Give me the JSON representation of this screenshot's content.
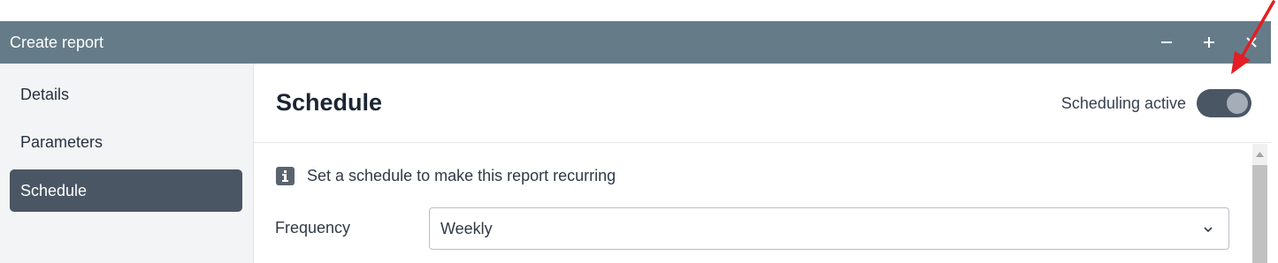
{
  "window": {
    "title": "Create report",
    "controls": {
      "minimize_icon": "minus-icon",
      "maximize_icon": "plus-icon",
      "close_icon": "close-icon"
    }
  },
  "sidebar": {
    "items": [
      {
        "label": "Details",
        "active": false
      },
      {
        "label": "Parameters",
        "active": false
      },
      {
        "label": "Schedule",
        "active": true
      }
    ]
  },
  "main": {
    "title": "Schedule",
    "scheduling_toggle": {
      "label": "Scheduling active",
      "on": true
    },
    "info": {
      "icon": "info-icon",
      "text": "Set a schedule to make this report recurring"
    },
    "frequency": {
      "label": "Frequency",
      "value": "Weekly"
    }
  },
  "annotation": {
    "icon": "red-arrow-icon",
    "color": "#e31e24"
  },
  "colors": {
    "titlebar": "#657c88",
    "sidebar_active": "#4a5664",
    "toggle_track": "#4a5664",
    "sidebar_bg": "#f3f4f6"
  }
}
